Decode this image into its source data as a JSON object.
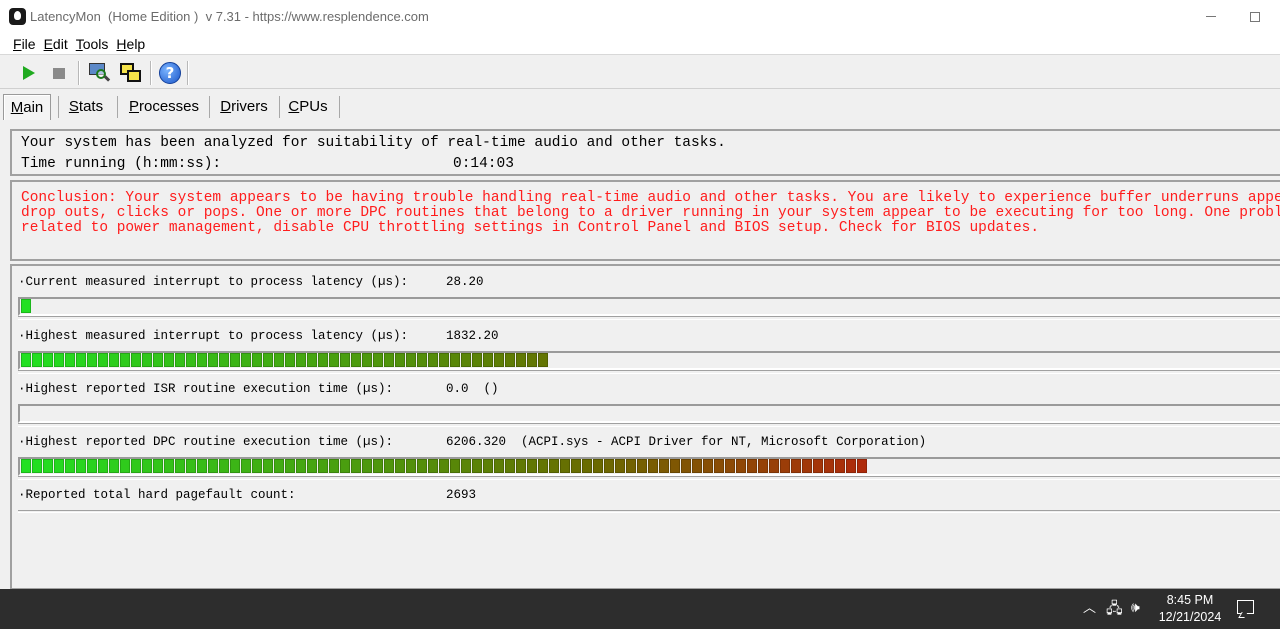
{
  "window": {
    "title": "LatencyMon  (Home Edition )  v 7.31 - https://www.resplendence.com"
  },
  "menu": [
    {
      "mnemonic": "F",
      "rest": "ile"
    },
    {
      "mnemonic": "E",
      "rest": "dit"
    },
    {
      "mnemonic": "T",
      "rest": "ools"
    },
    {
      "mnemonic": "H",
      "rest": "elp"
    }
  ],
  "toolbar": {
    "icons": [
      "play-icon",
      "stop-icon",
      "monitor-magnifier-icon",
      "windows-icon",
      "help-icon"
    ],
    "colors": {
      "play": "#1faa1f",
      "stop": "#8a8a8a",
      "help": "#1a55c8"
    }
  },
  "tabs": [
    {
      "mnemonic": "M",
      "rest": "ain",
      "active": true
    },
    {
      "mnemonic": "S",
      "rest": "tats",
      "active": false
    },
    {
      "mnemonic": "P",
      "rest": "rocesses",
      "active": false
    },
    {
      "mnemonic": "D",
      "rest": "rivers",
      "active": false
    },
    {
      "mnemonic": "C",
      "rest": "PUs",
      "active": false
    }
  ],
  "summary": {
    "line1": "Your system has been analyzed for suitability of real-time audio and other tasks.",
    "time_label": "Time running (h:mm:ss):",
    "time_value": "0:14:03"
  },
  "conclusion": {
    "text": "Conclusion: Your system appears to be having trouble handling real-time audio and other tasks. You are likely to experience buffer underruns appearing a\ndrop outs, clicks or pops. One or more DPC routines that belong to a driver running in your system appear to be executing for too long. One problem may\nrelated to power management, disable CPU throttling settings in Control Panel and BIOS setup. Check for BIOS updates.",
    "color": "#ff1c1c"
  },
  "metrics": [
    {
      "label": "·Current measured interrupt to process latency (µs):",
      "value": "28.20",
      "bar_segments": 1
    },
    {
      "label": "·Highest measured interrupt to process latency (µs):",
      "value": "1832.20",
      "bar_segments": 48
    },
    {
      "label": "·Highest reported ISR routine execution time (µs):",
      "value": "0.0  ()",
      "bar_segments": 0
    },
    {
      "label": "·Highest reported DPC routine execution time (µs):",
      "value": "6206.320  (ACPI.sys - ACPI Driver for NT, Microsoft Corporation)",
      "bar_segments": 77
    },
    {
      "label": "·Reported total hard pagefault count:",
      "value": "2693",
      "bar_segments": null
    }
  ],
  "bar_colors": {
    "green": "#22e022",
    "olive": "#6a6a00",
    "red": "#cc1010"
  },
  "taskbar": {
    "icons": [
      "chevron-up-icon",
      "network-icon",
      "display-icon",
      "volume-icon",
      "notification-icon"
    ],
    "time": "8:45 PM",
    "date": "12/21/2024"
  }
}
